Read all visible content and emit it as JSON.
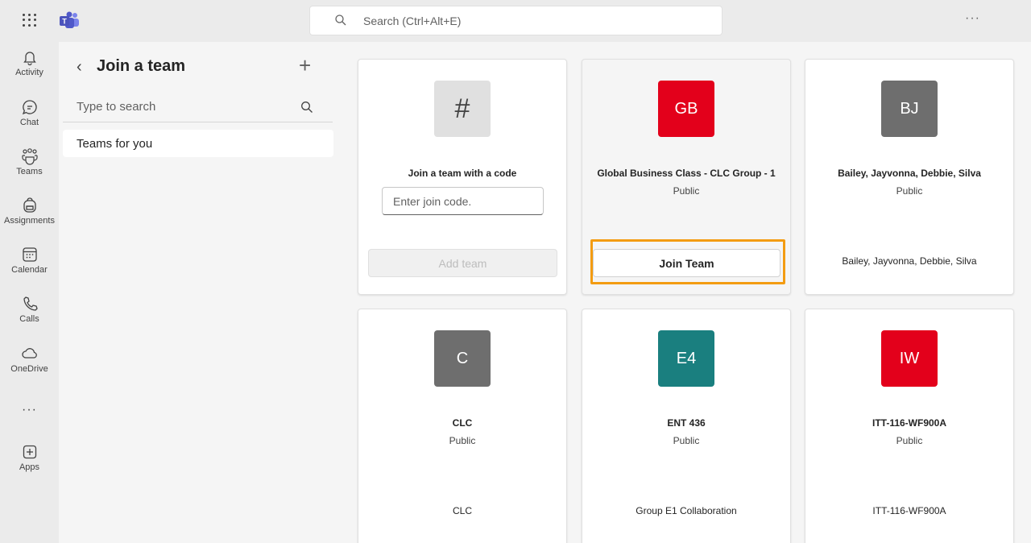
{
  "topbar": {
    "search_placeholder": "Search (Ctrl+Alt+E)",
    "more_label": "···"
  },
  "rail": {
    "items": [
      {
        "label": "Activity",
        "icon": "bell-icon"
      },
      {
        "label": "Chat",
        "icon": "chat-icon"
      },
      {
        "label": "Teams",
        "icon": "teams-icon"
      },
      {
        "label": "Assignments",
        "icon": "backpack-icon"
      },
      {
        "label": "Calendar",
        "icon": "calendar-icon"
      },
      {
        "label": "Calls",
        "icon": "phone-icon"
      },
      {
        "label": "OneDrive",
        "icon": "cloud-icon"
      },
      {
        "label": "···",
        "icon": "more-icon"
      },
      {
        "label": "Apps",
        "icon": "apps-icon"
      }
    ]
  },
  "pane": {
    "title": "Join a team",
    "search_placeholder": "Type to search",
    "selected_item": "Teams for you"
  },
  "code_card": {
    "title": "Join a team with a code",
    "input_placeholder": "Enter join code.",
    "button_label": "Add team"
  },
  "teams": [
    {
      "initials": "GB",
      "name": "Global Business Class - CLC Group - 1",
      "privacy": "Public",
      "description": "",
      "color": "#e3001b",
      "button_label": "Join Team"
    },
    {
      "initials": "BJ",
      "name": "Bailey, Jayvonna, Debbie, Silva",
      "privacy": "Public",
      "description": "Bailey, Jayvonna, Debbie, Silva",
      "color": "#6e6e6e"
    },
    {
      "initials": "C",
      "name": "CLC",
      "privacy": "Public",
      "description": "CLC",
      "color": "#6e6e6e"
    },
    {
      "initials": "E4",
      "name": "ENT 436",
      "privacy": "Public",
      "description": "Group E1 Collaboration",
      "color": "#1a7f7f"
    },
    {
      "initials": "IW",
      "name": "ITT-116-WF900A",
      "privacy": "Public",
      "description": "ITT-116-WF900A",
      "color": "#e3001b"
    }
  ],
  "colors": {
    "highlight": "#f39c12",
    "accent": "#5b5fc7"
  }
}
